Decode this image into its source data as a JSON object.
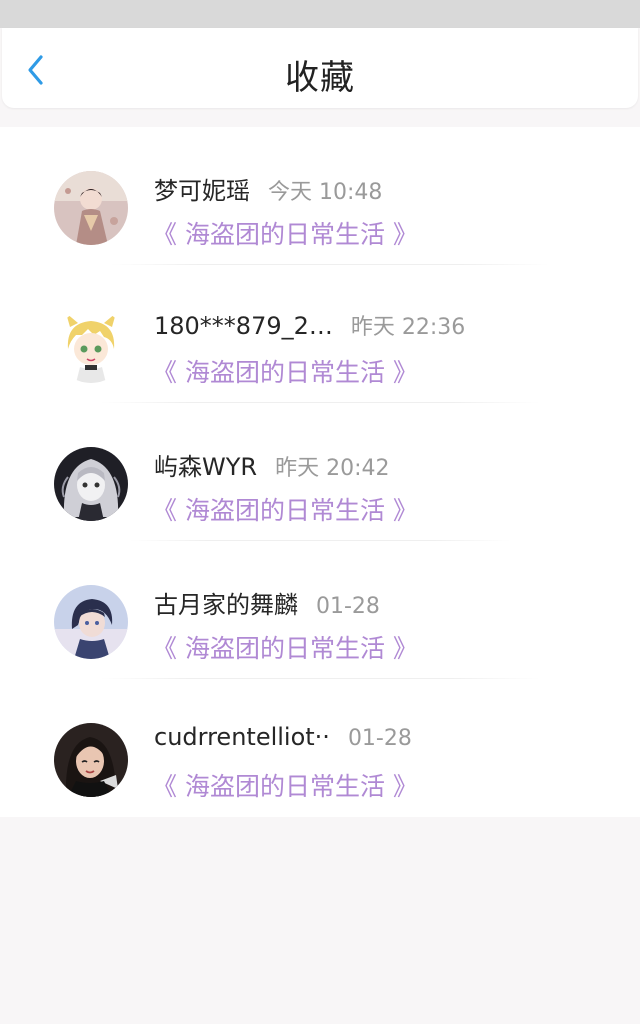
{
  "header": {
    "title": "收藏",
    "back_icon": "chevron-left-icon",
    "accent": "#2f9be6"
  },
  "colors": {
    "link": "#b089d4",
    "time": "#9a9a9a",
    "name": "#262626"
  },
  "favorites": [
    {
      "user": "梦可妮瑶",
      "time": "今天 10:48",
      "title": "《 海盗团的日常生活 》",
      "avatar": "avatar-1"
    },
    {
      "user": "180***879_2…",
      "time": "昨天 22:36",
      "title": "《 海盗团的日常生活 》",
      "avatar": "avatar-2"
    },
    {
      "user": "屿森WYR",
      "time": "昨天 20:42",
      "title": "《 海盗团的日常生活 》",
      "avatar": "avatar-3"
    },
    {
      "user": "古月家的舞麟",
      "time": "01-28",
      "title": "《 海盗团的日常生活 》",
      "avatar": "avatar-4"
    },
    {
      "user": "cudrrentelliot··",
      "time": "01-28",
      "title": "《 海盗团的日常生活 》",
      "avatar": "avatar-5"
    }
  ]
}
